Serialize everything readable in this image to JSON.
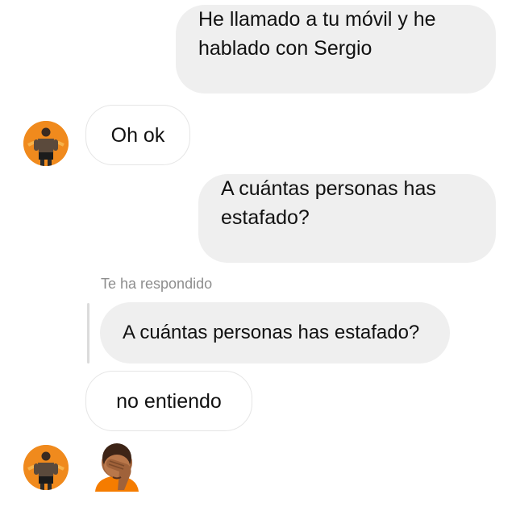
{
  "conversation": {
    "messages": [
      {
        "sender": "me",
        "text": "He llamado a tu móvil y he\nhablado con Sergio"
      },
      {
        "sender": "them",
        "text": "Oh ok"
      },
      {
        "sender": "me",
        "text": "A cuántas personas has\nestafado?"
      },
      {
        "sender": "them",
        "reply_label": "Te ha respondido",
        "quoted_text": "A cuántas personas has estafado?",
        "text": "no entiendo"
      },
      {
        "sender": "them",
        "emoji": "face-palm-emoji"
      }
    ]
  },
  "icons": {
    "avatar": "avatar-icon",
    "emoji": "face-palm-emoji"
  },
  "colors": {
    "sent_bubble": "#efefef",
    "received_bubble_border": "#e5e5e5",
    "reply_label": "#8e8e8e",
    "avatar_bg": "#f08a1d"
  }
}
